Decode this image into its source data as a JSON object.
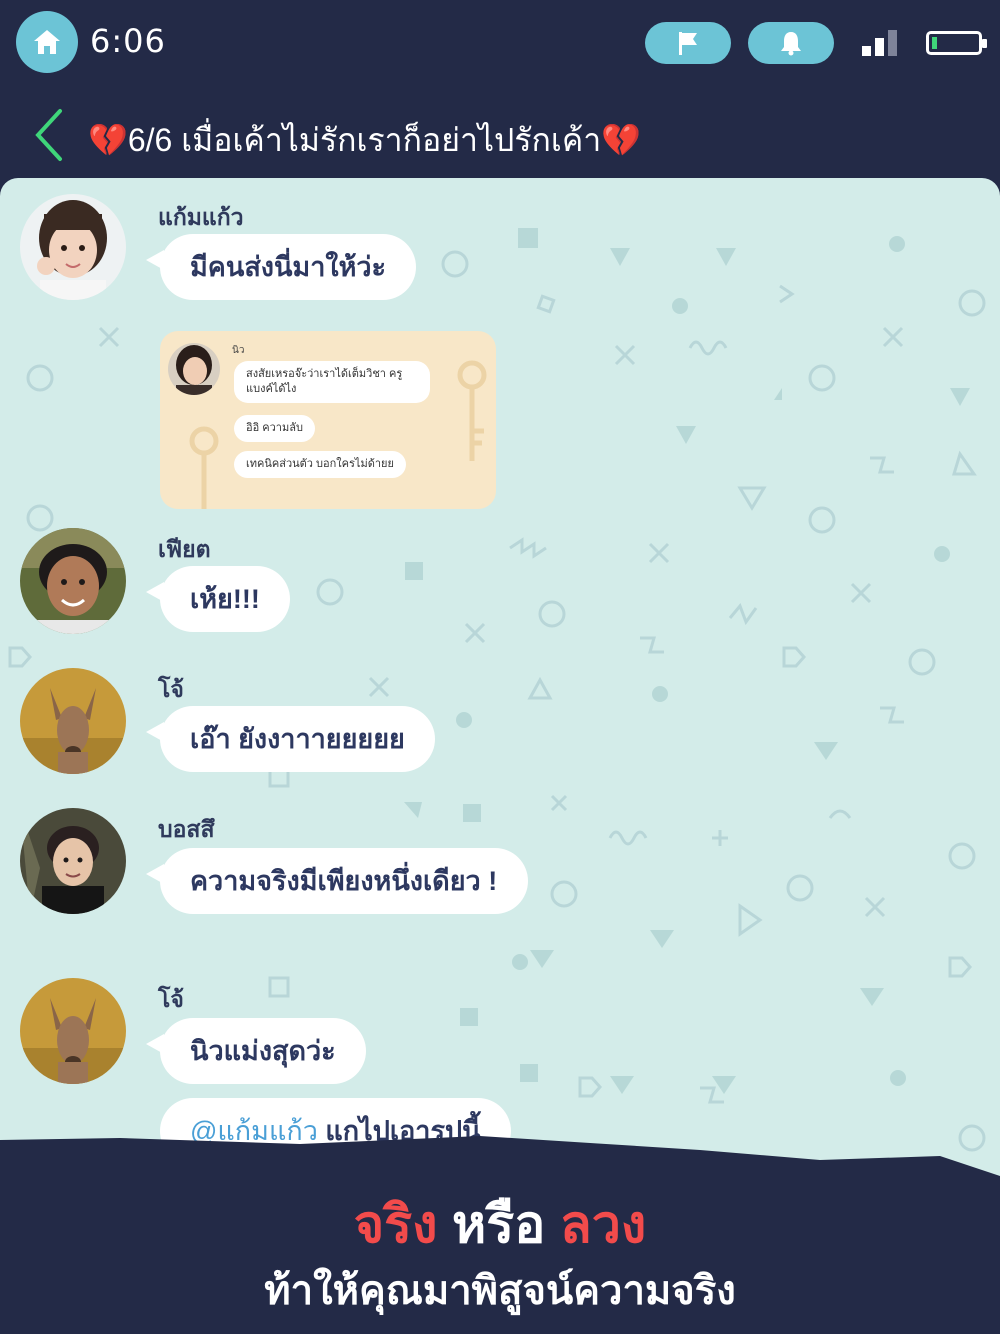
{
  "status_bar": {
    "time": "6:06",
    "icons": [
      "home-icon",
      "flag-icon",
      "bell-icon",
      "signal-icon",
      "battery-icon"
    ]
  },
  "header": {
    "back_icon": "chevron-left-icon",
    "title": "💔6/6 เมื่อเค้าไม่รักเราก็อย่าไปรักเค้า💔"
  },
  "messages": [
    {
      "sender": "แก้มแก้ว",
      "text": "มีคนส่งนี่มาให้ว่ะ"
    },
    {
      "sender": "แก้มแก้ว",
      "type": "image",
      "shared": {
        "name": "นิว",
        "lines": [
          "สงสัยเหรอจ๊ะว่าเราได้เต็มวิชา ครูแบงค์ได้ไง",
          "อิอิ ความลับ",
          "เทคนิคส่วนตัว บอกใครไม่ด้ายย"
        ]
      }
    },
    {
      "sender": "เฟียต",
      "text": "เห้ย!!!"
    },
    {
      "sender": "โจ้",
      "text": "เอ๊า ยังงาาายยยยย"
    },
    {
      "sender": "บอสสึ",
      "text": "ความจริงมีเพียงหนึ่งเดียว !"
    },
    {
      "sender": "โจ้",
      "text": "นิวแม่งสุดว่ะ"
    },
    {
      "sender": "โจ้",
      "mention": "@แก้มแก้ว",
      "text": "แกไปเอารูปนี้"
    }
  ],
  "promo": {
    "word_true": "จริง",
    "word_or": "หรือ",
    "word_fake": "ลวง",
    "subtitle": "ท้าให้คุณมาพิสูจน์ความจริง"
  },
  "colors": {
    "background": "#232a47",
    "accent": "#6cc4d6",
    "chat_bg": "#d3ece9",
    "promo_red": "#f24b4b",
    "back_arrow": "#3fd67a"
  }
}
